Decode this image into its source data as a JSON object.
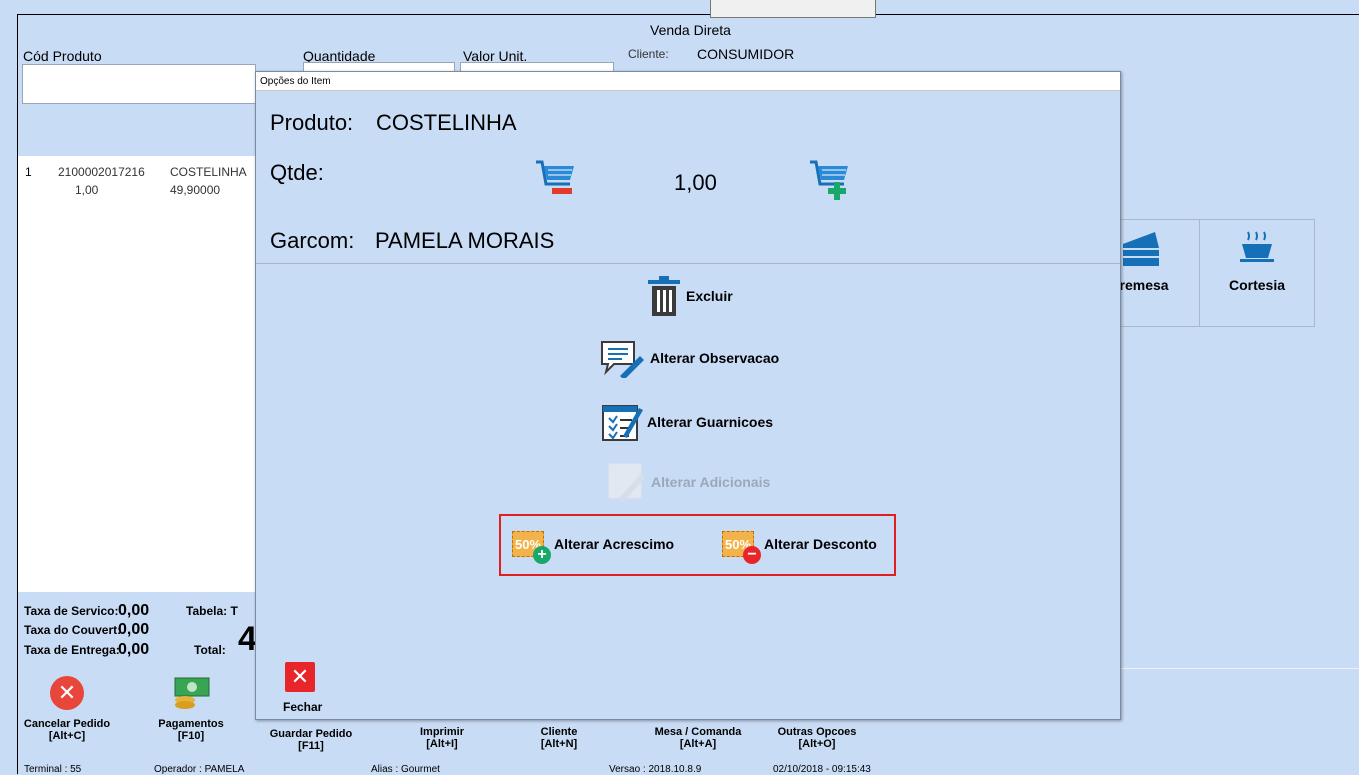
{
  "window": {
    "title": "Venda Direta",
    "cliente_label": "Cliente:",
    "cliente_value": "CONSUMIDOR"
  },
  "form": {
    "cod_produto_label": "Cód Produto",
    "quantidade_label": "Quantidade",
    "valor_unit_label": "Valor Unit."
  },
  "item_list": [
    {
      "index": "1",
      "code": "2100002017216",
      "name": "COSTELINHA",
      "qty": "1,00",
      "price": "49,90000"
    }
  ],
  "categories": [
    {
      "label": "premesa",
      "icon": "cake-icon"
    },
    {
      "label": "Cortesia",
      "icon": "coffee-cup-icon"
    }
  ],
  "totals": {
    "servico_label": "Taxa de Servico:",
    "servico_value": "0,00",
    "couvert_label": "Taxa do Couvert:",
    "couvert_value": "0,00",
    "entrega_label": "Taxa de Entrega:",
    "entrega_value": "0,00",
    "tabela_label": "Tabela: T",
    "total_label": "Total:",
    "total_value": "4"
  },
  "bottom_buttons": [
    {
      "label": "Cancelar Pedido",
      "shortcut": "[Alt+C]"
    },
    {
      "label": "Pagamentos",
      "shortcut": "[F10]"
    },
    {
      "label": "Guardar Pedido",
      "shortcut": "[F11]"
    },
    {
      "label": "Imprimir",
      "shortcut": "[Alt+I]"
    },
    {
      "label": "Cliente",
      "shortcut": "[Alt+N]"
    },
    {
      "label": "Mesa / Comanda",
      "shortcut": "[Alt+A]"
    },
    {
      "label": "Outras Opcoes",
      "shortcut": "[Alt+O]"
    }
  ],
  "status": {
    "terminal": "Terminal : 55",
    "operador": "Operador : PAMELA",
    "alias": "Alias : Gourmet",
    "versao": "Versao : 2018.10.8.9",
    "datetime": "02/10/2018 - 09:15:43"
  },
  "dialog": {
    "title": "Opções do Item",
    "produto_label": "Produto:",
    "produto_value": "COSTELINHA",
    "qtde_label": "Qtde:",
    "qtde_value": "1,00",
    "garcom_label": "Garcom:",
    "garcom_value": "PAMELA MORAIS",
    "actions": {
      "excluir": "Excluir",
      "observacao": "Alterar Observacao",
      "guarnicoes": "Alterar Guarnicoes",
      "adicionais": "Alterar Adicionais",
      "acrescimo": "Alterar Acrescimo",
      "desconto": "Alterar Desconto",
      "badge_text": "50%"
    },
    "fechar": "Fechar"
  },
  "colors": {
    "background": "#c9dcf5",
    "danger": "#e8463a",
    "highlight_border": "#e02020",
    "accent_green": "#1aa86a"
  }
}
